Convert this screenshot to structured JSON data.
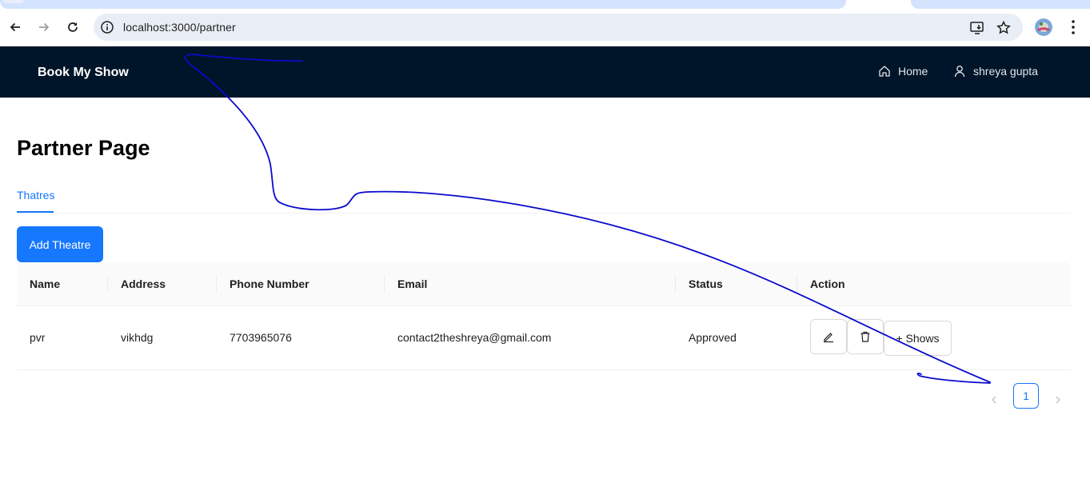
{
  "browser": {
    "url": "localhost:3000/partner"
  },
  "header": {
    "brand": "Book My Show",
    "nav": [
      {
        "label": "Home",
        "icon": "home-icon"
      },
      {
        "label": "shreya gupta",
        "icon": "user-icon"
      }
    ],
    "background": "#001529"
  },
  "page": {
    "title": "Partner Page",
    "tabs": [
      {
        "label": "Thatres",
        "active": true
      }
    ],
    "add_button": "Add Theatre"
  },
  "table": {
    "columns": [
      "Name",
      "Address",
      "Phone Number",
      "Email",
      "Status",
      "Action"
    ],
    "rows": [
      {
        "name": "pvr",
        "address": "vikhdg",
        "phone": "7703965076",
        "email": "contact2theshreya@gmail.com",
        "status": "Approved",
        "actions": {
          "edit_icon": "edit-icon",
          "delete_icon": "delete-icon",
          "shows_label": "+ Shows"
        }
      }
    ]
  },
  "pagination": {
    "current_page": "1"
  },
  "colors": {
    "primary": "#1677ff",
    "annotation": "#0000cc"
  }
}
